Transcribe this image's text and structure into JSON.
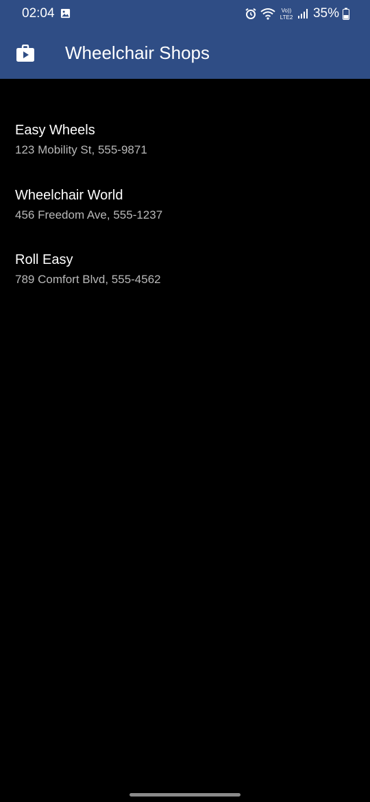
{
  "status_bar": {
    "time": "02:04",
    "battery": "35%",
    "network_badge_top": "Vo))",
    "network_badge_bottom": "LTE2",
    "icons": [
      "image-icon",
      "alarm-icon",
      "wifi-icon",
      "volte-lte-icon",
      "signal-icon",
      "battery-icon"
    ]
  },
  "app_bar": {
    "title": "Wheelchair Shops",
    "icon": "shop-bag-play-icon"
  },
  "shops": [
    {
      "name": "Easy Wheels",
      "address": "123 Mobility St, 555-9871"
    },
    {
      "name": "Wheelchair World",
      "address": "456 Freedom Ave, 555-1237"
    },
    {
      "name": "Roll Easy",
      "address": "789 Comfort Blvd, 555-4562"
    }
  ],
  "colors": {
    "app_bar": "#2f4d85",
    "background": "#000000",
    "primary_text": "#ffffff",
    "secondary_text": "#b9b9b9"
  }
}
